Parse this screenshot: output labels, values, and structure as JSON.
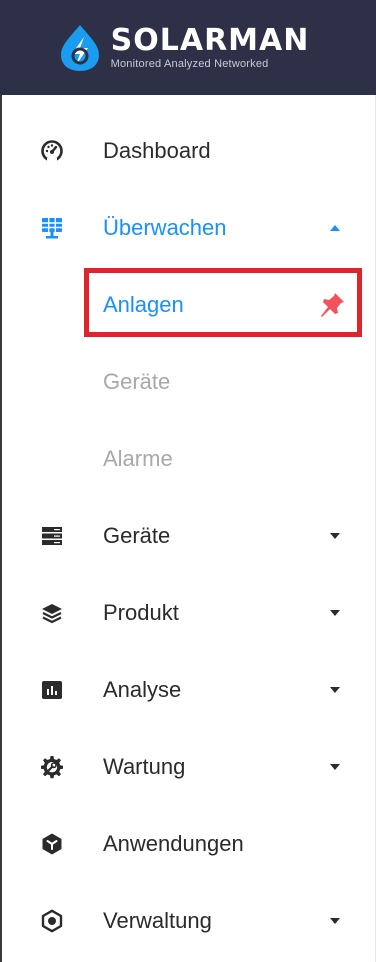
{
  "header": {
    "brand_name": "SOLARMAN",
    "tagline": "Monitored Analyzed Networked"
  },
  "colors": {
    "header_bg": "#2d3047",
    "accent": "#1890ff",
    "text": "#2b2b2b",
    "muted": "#a8a8a8",
    "highlight": "#e0242e",
    "pin": "#f4525a"
  },
  "menu": {
    "dashboard": {
      "label": "Dashboard",
      "icon": "speedometer-icon"
    },
    "ueberwachen": {
      "label": "Überwachen",
      "icon": "solar-panel-icon",
      "expanded": true,
      "submenu": {
        "anlagen": {
          "label": "Anlagen",
          "icon": "pin-icon",
          "selected": true
        },
        "geraete": {
          "label": "Geräte"
        },
        "alarme": {
          "label": "Alarme"
        }
      }
    },
    "geraete": {
      "label": "Geräte",
      "icon": "server-icon"
    },
    "produkt": {
      "label": "Produkt",
      "icon": "layers-icon"
    },
    "analyse": {
      "label": "Analyse",
      "icon": "bar-chart-icon"
    },
    "wartung": {
      "label": "Wartung",
      "icon": "gear-wrench-icon"
    },
    "anwendungen": {
      "label": "Anwendungen",
      "icon": "hexagon-cube-icon"
    },
    "verwaltung": {
      "label": "Verwaltung",
      "icon": "hexagon-circle-icon"
    }
  }
}
